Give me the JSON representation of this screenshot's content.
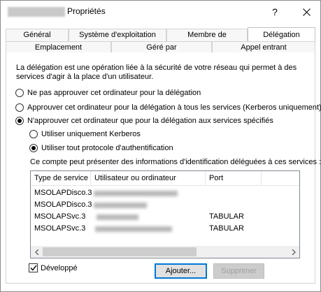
{
  "window": {
    "title": "Propriétés",
    "help": "?",
    "close_icon": "close-icon"
  },
  "tabs_row1": [
    {
      "label": "Général",
      "active": false
    },
    {
      "label": "Système d'exploitation",
      "active": false
    },
    {
      "label": "Membre de",
      "active": false
    },
    {
      "label": "Délégation",
      "active": true
    }
  ],
  "tabs_row2": [
    {
      "label": "Emplacement"
    },
    {
      "label": "Géré par"
    },
    {
      "label": "Appel entrant"
    }
  ],
  "delegation": {
    "description": "La délégation est une opération liée à la sécurité de votre réseau qui permet à des services d'agir à la place d'un utilisateur.",
    "options": [
      {
        "label": "Ne pas approuver cet ordinateur pour la délégation",
        "selected": false
      },
      {
        "label": "Approuver cet ordinateur pour la délégation à tous les services (Kerberos uniquement)",
        "selected": false
      },
      {
        "label": "N'approuver cet ordinateur que pour la délégation aux services spécifiés",
        "selected": true
      }
    ],
    "sub_options": [
      {
        "label": "Utiliser uniquement Kerberos",
        "selected": false
      },
      {
        "label": "Utiliser tout protocole d'authentification",
        "selected": true
      }
    ],
    "list_label": "Ce compte peut présenter des informations d'identification déléguées à ces services :",
    "columns": [
      "Type de service",
      "Utilisateur ou ordinateur",
      "Port"
    ],
    "rows": [
      {
        "service": "MSOLAPDisco.3",
        "port": ""
      },
      {
        "service": "MSOLAPDisco.3",
        "port": ""
      },
      {
        "service": "MSOLAPSvc.3",
        "port": "TABULAR"
      },
      {
        "service": "MSOLAPSvc.3",
        "port": "TABULAR"
      }
    ],
    "expanded_label": "Développé",
    "expanded_checked": true,
    "add_button": "Ajouter...",
    "remove_button": "Supprimer"
  }
}
